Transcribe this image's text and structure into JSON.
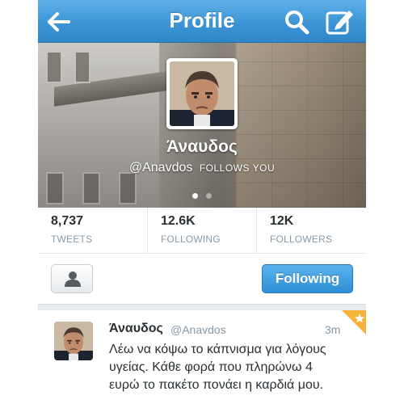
{
  "nav": {
    "title": "Profile",
    "back_icon": "back-arrow-icon",
    "search_icon": "search-icon",
    "compose_icon": "compose-icon",
    "bar_color": "#3d95d6"
  },
  "profile": {
    "display_name": "Άναυδος",
    "handle": "@Anavdos",
    "follows_you": "FOLLOWS YOU",
    "avatar_icon": "profile-avatar",
    "page_dots": {
      "count": 2,
      "active": 1
    }
  },
  "stats": [
    {
      "value": "8,737",
      "label": "TWEETS"
    },
    {
      "value": "12.6K",
      "label": "FOLLOWING"
    },
    {
      "value": "12K",
      "label": "FOLLOWERS"
    }
  ],
  "actions": {
    "person_icon": "person-icon",
    "following_label": "Following",
    "accent": "#2f8fd5"
  },
  "tweet": {
    "name": "Άναυδος",
    "handle": "@Anavdos",
    "time": "3m",
    "lines": [
      "Λέω να κόψω το κάπνισμα για λόγους",
      "υγείας. Κάθε φορά που πληρώνω 4",
      "ευρώ το πακέτο πονάει η καρδιά μου."
    ],
    "favorite_icon": "star-icon",
    "favorite_color": "#f5b338"
  }
}
